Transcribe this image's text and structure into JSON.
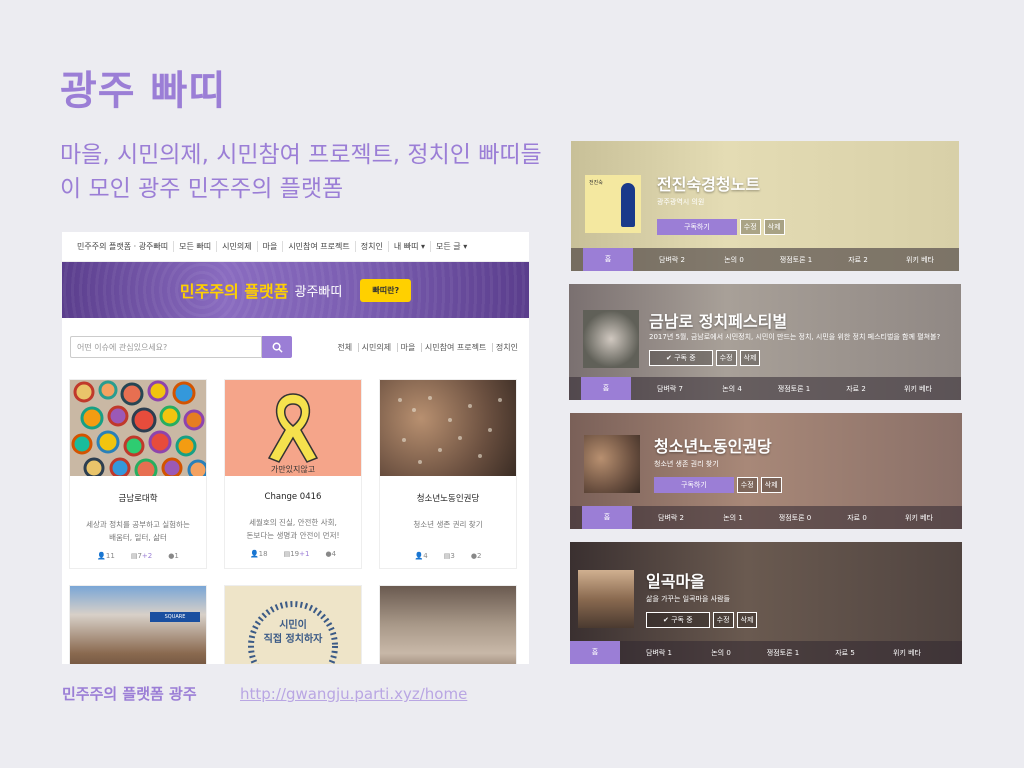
{
  "slide": {
    "title": "광주 빠띠",
    "subtitle": "마을, 시민의제, 시민참여 프로젝트, 정치인 빠띠들이 모인 광주 민주주의 플랫폼",
    "footer_label": "민주주의 플랫폼 광주",
    "footer_link": "http://gwangju.parti.xyz/home"
  },
  "site": {
    "nav": [
      "민주주의 플랫폼 · 광주빠띠",
      "모든 빠띠",
      "시민의제",
      "마을",
      "시민참여 프로젝트",
      "정치인",
      "내 빠띠 ▾",
      "모든 글 ▾"
    ],
    "banner_main": "민주주의 플랫폼",
    "banner_sub": "광주빠띠",
    "banner_button": "빠띠란?",
    "search_placeholder": "어떤 이슈에 관심있으세요?",
    "filters": [
      "전체",
      "시민의제",
      "마을",
      "시민참여 프로젝트",
      "정치인"
    ],
    "cards": [
      {
        "title": "금남로대학",
        "desc1": "세상과 정치를 공부하고 실험하는",
        "desc2": "배움터, 일터, 삶터",
        "members": "11",
        "posts": "7",
        "new": "+2",
        "comments": "1"
      },
      {
        "title": "Change 0416",
        "desc1": "세월호의 진실, 안전한 사회,",
        "desc2": "돈보다는 생명과 안전이 먼저!",
        "members": "18",
        "posts": "19",
        "new": "+1",
        "comments": "4",
        "img_text": "가만있지않고"
      },
      {
        "title": "청소년노동인권당",
        "desc1": "청소년 생존 권리 찾기",
        "desc2": "",
        "members": "4",
        "posts": "3",
        "new": "",
        "comments": "2"
      }
    ],
    "card4_sign": "SQUARE",
    "card5_text1": "시민이",
    "card5_text2": "직접 정치하자"
  },
  "panels": [
    {
      "title": "전진숙경청노트",
      "desc": "광주광역시 의원",
      "subscribe": "구독하기",
      "edit": "수정",
      "del": "삭제",
      "tabs": [
        "홈",
        "담벼락 2",
        "논의 0",
        "쟁점토론 1",
        "자료 2",
        "위키 베타"
      ],
      "thumb_text": "전진숙"
    },
    {
      "title": "금남로 정치페스티벌",
      "desc": "2017년 5월, 금남로에서 시민정치, 시민이 만드는 정치, 시민을 위한 정치 페스티벌을 함께 펼쳐볼?",
      "subscribe": "✔ 구독 중",
      "edit": "수정",
      "del": "삭제",
      "tabs": [
        "홈",
        "담벼락 7",
        "논의 4",
        "쟁점토론 1",
        "자료 2",
        "위키 베타"
      ]
    },
    {
      "title": "청소년노동인권당",
      "desc": "청소년 생존 권리 찾기",
      "subscribe": "구독하기",
      "edit": "수정",
      "del": "삭제",
      "tabs": [
        "홈",
        "담벼락 2",
        "논의 1",
        "쟁점토론 0",
        "자료 0",
        "위키 베타"
      ]
    },
    {
      "title": "일곡마을",
      "desc": "삶을 가꾸는 일곡마을 사람들",
      "subscribe": "✔ 구독 중",
      "edit": "수정",
      "del": "삭제",
      "tabs": [
        "홈",
        "담벼락 1",
        "논의 0",
        "쟁점토론 1",
        "자료 5",
        "위키 베타"
      ]
    }
  ],
  "colors": {
    "accent": "#9b7ed6",
    "banner_yellow": "#ffd000"
  }
}
